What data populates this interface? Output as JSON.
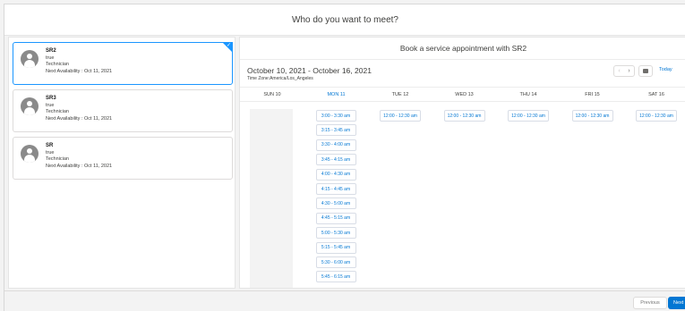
{
  "header": {
    "title": "Who do you want to meet?"
  },
  "resources": [
    {
      "name": "SR2",
      "line1": "true",
      "role": "Technician",
      "availability": "Next Availability : Oct 11, 2021",
      "selected": true
    },
    {
      "name": "SR3",
      "line1": "true",
      "role": "Technician",
      "availability": "Next Availability : Oct 11, 2021",
      "selected": false
    },
    {
      "name": "SR",
      "line1": "true",
      "role": "Technician",
      "availability": "Next Availability : Oct 11, 2021",
      "selected": false
    }
  ],
  "scheduler": {
    "title": "Book a service appointment with SR2",
    "date_range": "October 10, 2021 - October 16, 2021",
    "timezone": "Time Zone:America/Los_Angeles",
    "today_label": "Today",
    "prev_icon": "chevron-left-icon",
    "next_icon": "chevron-right-icon",
    "calendar_icon": "calendar-icon",
    "days": [
      {
        "label": "SUN 10",
        "active": false,
        "slots": []
      },
      {
        "label": "MON 11",
        "active": true,
        "slots": [
          "3:00 - 3:30 am",
          "3:15 - 3:45 am",
          "3:30 - 4:00 am",
          "3:45 - 4:15 am",
          "4:00 - 4:30 am",
          "4:15 - 4:45 am",
          "4:30 - 5:00 am",
          "4:45 - 5:15 am",
          "5:00 - 5:30 am",
          "5:15 - 5:45 am",
          "5:30 - 6:00 am",
          "5:45 - 6:15 am"
        ]
      },
      {
        "label": "TUE 12",
        "active": false,
        "slots": [
          "12:00 - 12:30 am"
        ]
      },
      {
        "label": "WED 13",
        "active": false,
        "slots": [
          "12:00 - 12:30 am"
        ]
      },
      {
        "label": "THU 14",
        "active": false,
        "slots": [
          "12:00 - 12:30 am"
        ]
      },
      {
        "label": "FRI 15",
        "active": false,
        "slots": [
          "12:00 - 12:30 am"
        ]
      },
      {
        "label": "SAT 16",
        "active": false,
        "slots": [
          "12:00 - 12:30 am"
        ]
      }
    ]
  },
  "footer": {
    "previous_label": "Previous",
    "next_label": "Next"
  },
  "colors": {
    "accent": "#0176d3",
    "selected_border": "#1b96ff"
  }
}
